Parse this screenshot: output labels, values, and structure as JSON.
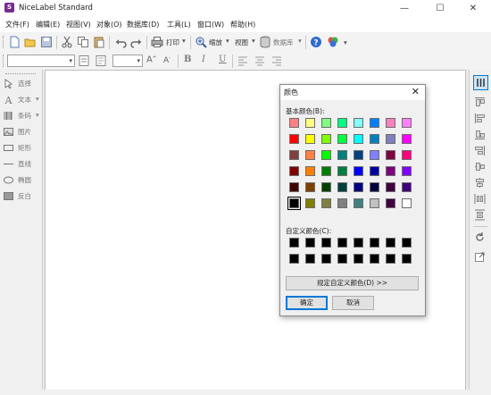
{
  "window": {
    "title": "NiceLabel Standard",
    "controls": [
      "—",
      "☐",
      "✕"
    ]
  },
  "menu": [
    "文件(F)",
    "编辑(E)",
    "视图(V)",
    "对象(O)",
    "数据库(D)",
    "工具(L)",
    "窗口(W)",
    "帮助(H)"
  ],
  "toolbar": {
    "print_label": "打印",
    "zoom_label": "缩放",
    "view_label": "视图",
    "database_label": "数据库",
    "bold": "B",
    "italic": "I",
    "underline": "U"
  },
  "left_tools": [
    {
      "label": "选择",
      "icon": "cursor-icon"
    },
    {
      "label": "文本",
      "icon": "text-icon"
    },
    {
      "label": "条码",
      "icon": "barcode-icon"
    },
    {
      "label": "图片",
      "icon": "picture-icon"
    },
    {
      "label": "矩形",
      "icon": "rectangle-icon"
    },
    {
      "label": "直线",
      "icon": "line-icon"
    },
    {
      "label": "椭圆",
      "icon": "ellipse-icon"
    },
    {
      "label": "反白",
      "icon": "inverse-icon"
    }
  ],
  "dialog": {
    "title": "颜色",
    "basic_colors_label": "基本颜色(B):",
    "custom_colors_label": "自定义颜色(C):",
    "define_custom_button": "规定自定义颜色(D) >>",
    "ok_button": "确定",
    "cancel_button": "取消",
    "basic_colors": [
      [
        "#FF8080",
        "#FFFF80",
        "#80FF80",
        "#00FF80",
        "#80FFFF",
        "#0080FF",
        "#FF80C0",
        "#FF80FF"
      ],
      [
        "#FF0000",
        "#FFFF00",
        "#80FF00",
        "#00FF40",
        "#00FFFF",
        "#0080C0",
        "#8080C0",
        "#FF00FF"
      ],
      [
        "#804040",
        "#FF8040",
        "#00FF00",
        "#008080",
        "#004080",
        "#8080FF",
        "#800040",
        "#FF0080"
      ],
      [
        "#800000",
        "#FF8000",
        "#008000",
        "#008040",
        "#0000FF",
        "#0000A0",
        "#800080",
        "#8000FF"
      ],
      [
        "#400000",
        "#804000",
        "#004000",
        "#004040",
        "#000080",
        "#000040",
        "#400040",
        "#400080"
      ],
      [
        "#000000",
        "#808000",
        "#808040",
        "#808080",
        "#408080",
        "#C0C0C0",
        "#400040",
        "#FFFFFF"
      ]
    ],
    "selected_color": "#000000",
    "custom_colors": [
      [
        "#000000",
        "#000000",
        "#000000",
        "#000000",
        "#000000",
        "#000000",
        "#000000",
        "#000000"
      ],
      [
        "#000000",
        "#000000",
        "#000000",
        "#000000",
        "#000000",
        "#000000",
        "#000000",
        "#000000"
      ]
    ]
  }
}
